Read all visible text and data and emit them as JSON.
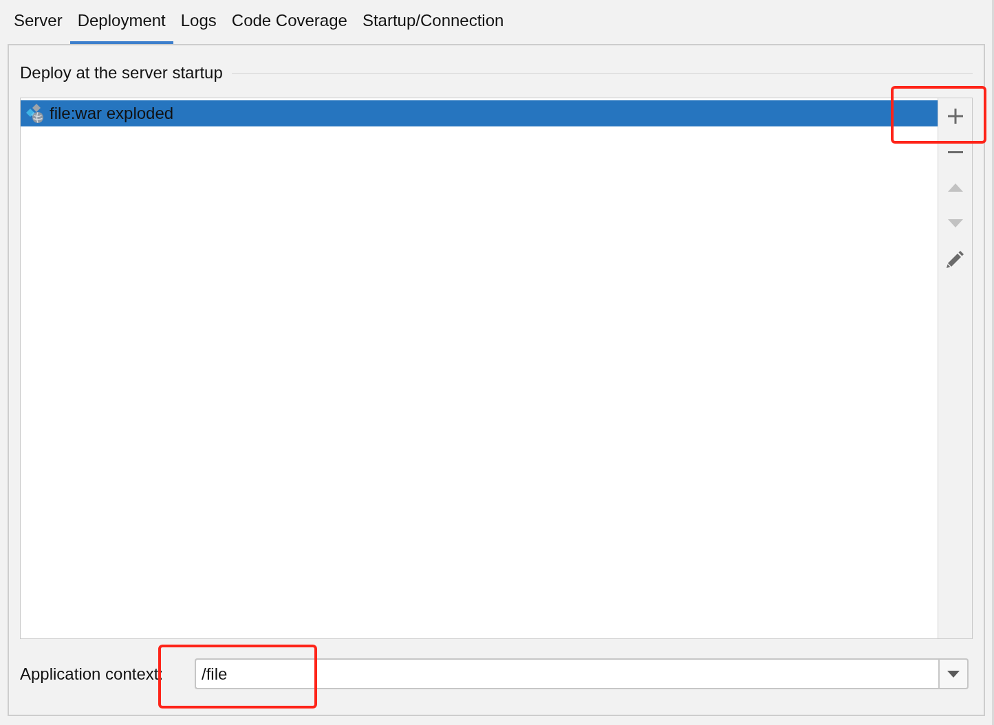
{
  "tabs": [
    {
      "label": "Server",
      "selected": false
    },
    {
      "label": "Deployment",
      "selected": true
    },
    {
      "label": "Logs",
      "selected": false
    },
    {
      "label": "Code Coverage",
      "selected": false
    },
    {
      "label": "Startup/Connection",
      "selected": false
    }
  ],
  "deployment": {
    "section_title": "Deploy at the server startup",
    "artifacts": [
      {
        "label": "file:war exploded",
        "selected": true
      }
    ],
    "toolbar": [
      {
        "kind": "add",
        "disabled": false,
        "highlighted": true
      },
      {
        "kind": "remove",
        "disabled": false,
        "highlighted": false
      },
      {
        "kind": "move_up",
        "disabled": true,
        "highlighted": false
      },
      {
        "kind": "move_down",
        "disabled": true,
        "highlighted": false
      },
      {
        "kind": "edit",
        "disabled": false,
        "highlighted": false
      }
    ]
  },
  "application_context": {
    "label": "Application context:",
    "value": "/file",
    "highlighted": true
  }
}
